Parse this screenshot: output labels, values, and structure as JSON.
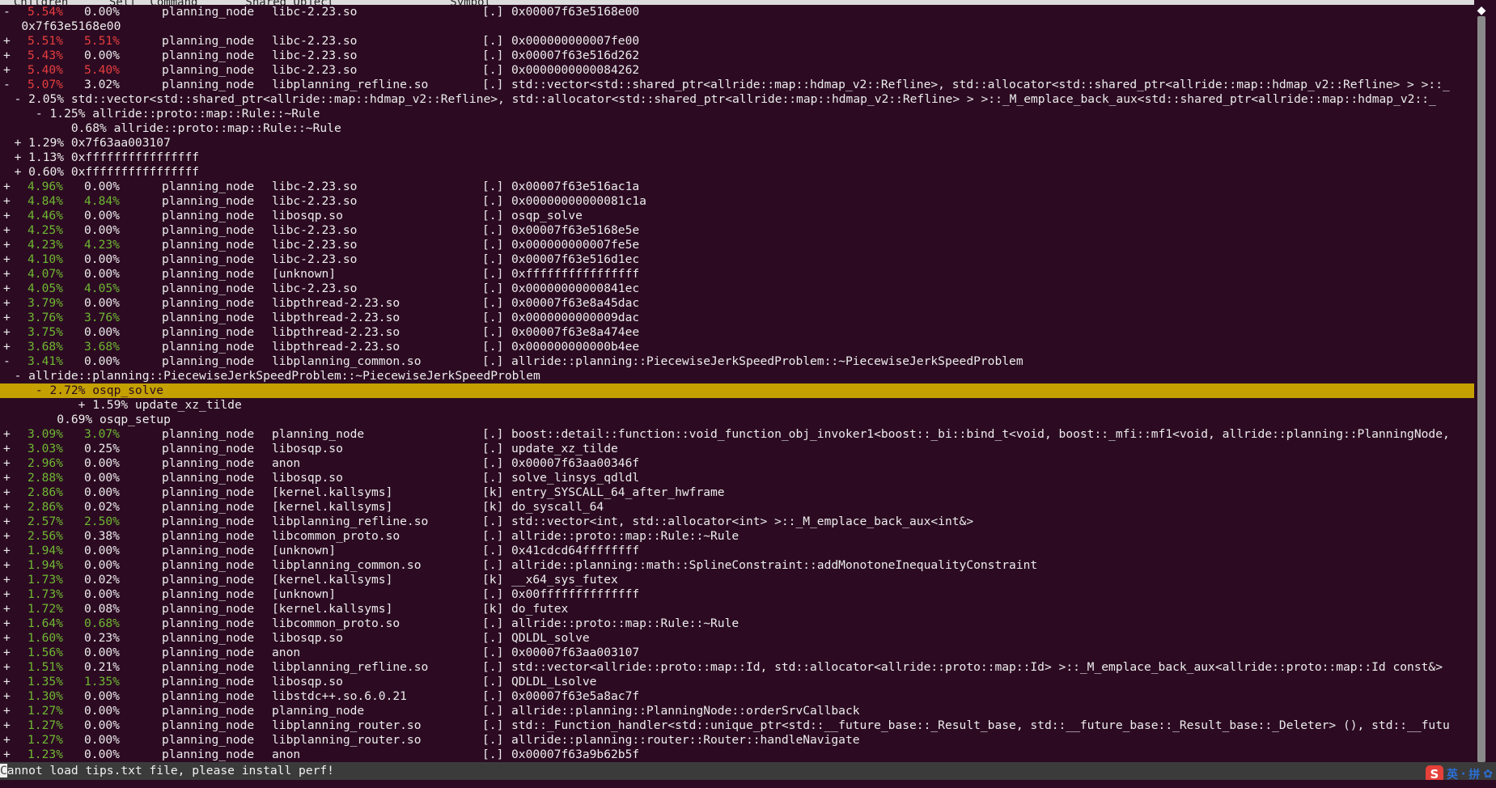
{
  "header": {
    "text": "  Children      Self  Command       Shared Object                 Symbol"
  },
  "lines": [
    {
      "p": "-",
      "c": "5.54%",
      "s": "0.00%",
      "cc": "red",
      "sc": "white",
      "cmd": "planning_node",
      "obj": "libc-2.23.so",
      "typ": "[.]",
      "sym": "0x00007f63e5168e00"
    },
    {
      "t": "   0x7f63e5168e00"
    },
    {
      "p": "+",
      "c": "5.51%",
      "s": "5.51%",
      "cc": "red",
      "sc": "red",
      "cmd": "planning_node",
      "obj": "libc-2.23.so",
      "typ": "[.]",
      "sym": "0x000000000007fe00"
    },
    {
      "p": "+",
      "c": "5.43%",
      "s": "0.00%",
      "cc": "red",
      "sc": "white",
      "cmd": "planning_node",
      "obj": "libc-2.23.so",
      "typ": "[.]",
      "sym": "0x00007f63e516d262"
    },
    {
      "p": "+",
      "c": "5.40%",
      "s": "5.40%",
      "cc": "red",
      "sc": "red",
      "cmd": "planning_node",
      "obj": "libc-2.23.so",
      "typ": "[.]",
      "sym": "0x0000000000084262"
    },
    {
      "p": "-",
      "c": "5.07%",
      "s": "3.02%",
      "cc": "red",
      "sc": "white",
      "cmd": "planning_node",
      "obj": "libplanning_refline.so",
      "typ": "[.]",
      "sym": "std::vector<std::shared_ptr<allride::map::hdmap_v2::Refline>, std::allocator<std::shared_ptr<allride::map::hdmap_v2::Refline> > >::_"
    },
    {
      "t": "  - 2.05% std::vector<std::shared_ptr<allride::map::hdmap_v2::Refline>, std::allocator<std::shared_ptr<allride::map::hdmap_v2::Refline> > >::_M_emplace_back_aux<std::shared_ptr<allride::map::hdmap_v2::_"
    },
    {
      "t": "     - 1.25% allride::proto::map::Rule::~Rule"
    },
    {
      "t": "          0.68% allride::proto::map::Rule::~Rule"
    },
    {
      "t": "  + 1.29% 0x7f63aa003107"
    },
    {
      "t": "  + 1.13% 0xffffffffffffffff"
    },
    {
      "t": "  + 0.60% 0xffffffffffffffff"
    },
    {
      "p": "+",
      "c": "4.96%",
      "s": "0.00%",
      "cc": "green",
      "sc": "white",
      "cmd": "planning_node",
      "obj": "libc-2.23.so",
      "typ": "[.]",
      "sym": "0x00007f63e516ac1a"
    },
    {
      "p": "+",
      "c": "4.84%",
      "s": "4.84%",
      "cc": "green",
      "sc": "green",
      "cmd": "planning_node",
      "obj": "libc-2.23.so",
      "typ": "[.]",
      "sym": "0x00000000000081c1a"
    },
    {
      "p": "+",
      "c": "4.46%",
      "s": "0.00%",
      "cc": "green",
      "sc": "white",
      "cmd": "planning_node",
      "obj": "libosqp.so",
      "typ": "[.]",
      "sym": "osqp_solve"
    },
    {
      "p": "+",
      "c": "4.25%",
      "s": "0.00%",
      "cc": "green",
      "sc": "white",
      "cmd": "planning_node",
      "obj": "libc-2.23.so",
      "typ": "[.]",
      "sym": "0x00007f63e5168e5e"
    },
    {
      "p": "+",
      "c": "4.23%",
      "s": "4.23%",
      "cc": "green",
      "sc": "green",
      "cmd": "planning_node",
      "obj": "libc-2.23.so",
      "typ": "[.]",
      "sym": "0x000000000007fe5e"
    },
    {
      "p": "+",
      "c": "4.10%",
      "s": "0.00%",
      "cc": "green",
      "sc": "white",
      "cmd": "planning_node",
      "obj": "libc-2.23.so",
      "typ": "[.]",
      "sym": "0x00007f63e516d1ec"
    },
    {
      "p": "+",
      "c": "4.07%",
      "s": "0.00%",
      "cc": "green",
      "sc": "white",
      "cmd": "planning_node",
      "obj": "[unknown]",
      "typ": "[.]",
      "sym": "0xffffffffffffffff"
    },
    {
      "p": "+",
      "c": "4.05%",
      "s": "4.05%",
      "cc": "green",
      "sc": "green",
      "cmd": "planning_node",
      "obj": "libc-2.23.so",
      "typ": "[.]",
      "sym": "0x00000000000841ec"
    },
    {
      "p": "+",
      "c": "3.79%",
      "s": "0.00%",
      "cc": "green",
      "sc": "white",
      "cmd": "planning_node",
      "obj": "libpthread-2.23.so",
      "typ": "[.]",
      "sym": "0x00007f63e8a45dac"
    },
    {
      "p": "+",
      "c": "3.76%",
      "s": "3.76%",
      "cc": "green",
      "sc": "green",
      "cmd": "planning_node",
      "obj": "libpthread-2.23.so",
      "typ": "[.]",
      "sym": "0x0000000000009dac"
    },
    {
      "p": "+",
      "c": "3.75%",
      "s": "0.00%",
      "cc": "green",
      "sc": "white",
      "cmd": "planning_node",
      "obj": "libpthread-2.23.so",
      "typ": "[.]",
      "sym": "0x00007f63e8a474ee"
    },
    {
      "p": "+",
      "c": "3.68%",
      "s": "3.68%",
      "cc": "green",
      "sc": "green",
      "cmd": "planning_node",
      "obj": "libpthread-2.23.so",
      "typ": "[.]",
      "sym": "0x000000000000b4ee"
    },
    {
      "p": "-",
      "c": "3.41%",
      "s": "0.00%",
      "cc": "green",
      "sc": "white",
      "cmd": "planning_node",
      "obj": "libplanning_common.so",
      "typ": "[.]",
      "sym": "allride::planning::PiecewiseJerkSpeedProblem::~PiecewiseJerkSpeedProblem"
    },
    {
      "t": "  - allride::planning::PiecewiseJerkSpeedProblem::~PiecewiseJerkSpeedProblem"
    },
    {
      "t": "     - 2.72% osqp_solve",
      "hl": true
    },
    {
      "t": "           + 1.59% update_xz_tilde"
    },
    {
      "t": "        0.69% osqp_setup"
    },
    {
      "p": "+",
      "c": "3.09%",
      "s": "3.07%",
      "cc": "green",
      "sc": "green",
      "cmd": "planning_node",
      "obj": "planning_node",
      "typ": "[.]",
      "sym": "boost::detail::function::void_function_obj_invoker1<boost::_bi::bind_t<void, boost::_mfi::mf1<void, allride::planning::PlanningNode,"
    },
    {
      "p": "+",
      "c": "3.03%",
      "s": "0.25%",
      "cc": "green",
      "sc": "white",
      "cmd": "planning_node",
      "obj": "libosqp.so",
      "typ": "[.]",
      "sym": "update_xz_tilde"
    },
    {
      "p": "+",
      "c": "2.96%",
      "s": "0.00%",
      "cc": "green",
      "sc": "white",
      "cmd": "planning_node",
      "obj": "anon",
      "typ": "[.]",
      "sym": "0x00007f63aa00346f"
    },
    {
      "p": "+",
      "c": "2.88%",
      "s": "0.00%",
      "cc": "green",
      "sc": "white",
      "cmd": "planning_node",
      "obj": "libosqp.so",
      "typ": "[.]",
      "sym": "solve_linsys_qdldl"
    },
    {
      "p": "+",
      "c": "2.86%",
      "s": "0.00%",
      "cc": "green",
      "sc": "white",
      "cmd": "planning_node",
      "obj": "[kernel.kallsyms]",
      "typ": "[k]",
      "sym": "entry_SYSCALL_64_after_hwframe"
    },
    {
      "p": "+",
      "c": "2.86%",
      "s": "0.02%",
      "cc": "green",
      "sc": "white",
      "cmd": "planning_node",
      "obj": "[kernel.kallsyms]",
      "typ": "[k]",
      "sym": "do_syscall_64"
    },
    {
      "p": "+",
      "c": "2.57%",
      "s": "2.50%",
      "cc": "green",
      "sc": "green",
      "cmd": "planning_node",
      "obj": "libplanning_refline.so",
      "typ": "[.]",
      "sym": "std::vector<int, std::allocator<int> >::_M_emplace_back_aux<int&>"
    },
    {
      "p": "+",
      "c": "2.56%",
      "s": "0.38%",
      "cc": "green",
      "sc": "white",
      "cmd": "planning_node",
      "obj": "libcommon_proto.so",
      "typ": "[.]",
      "sym": "allride::proto::map::Rule::~Rule"
    },
    {
      "p": "+",
      "c": "1.94%",
      "s": "0.00%",
      "cc": "green",
      "sc": "white",
      "cmd": "planning_node",
      "obj": "[unknown]",
      "typ": "[.]",
      "sym": "0x41cdcd64ffffffff"
    },
    {
      "p": "+",
      "c": "1.94%",
      "s": "0.00%",
      "cc": "green",
      "sc": "white",
      "cmd": "planning_node",
      "obj": "libplanning_common.so",
      "typ": "[.]",
      "sym": "allride::planning::math::SplineConstraint::addMonotoneInequalityConstraint"
    },
    {
      "p": "+",
      "c": "1.73%",
      "s": "0.02%",
      "cc": "green",
      "sc": "white",
      "cmd": "planning_node",
      "obj": "[kernel.kallsyms]",
      "typ": "[k]",
      "sym": "__x64_sys_futex"
    },
    {
      "p": "+",
      "c": "1.73%",
      "s": "0.00%",
      "cc": "green",
      "sc": "white",
      "cmd": "planning_node",
      "obj": "[unknown]",
      "typ": "[.]",
      "sym": "0x00ffffffffffffff"
    },
    {
      "p": "+",
      "c": "1.72%",
      "s": "0.08%",
      "cc": "green",
      "sc": "white",
      "cmd": "planning_node",
      "obj": "[kernel.kallsyms]",
      "typ": "[k]",
      "sym": "do_futex"
    },
    {
      "p": "+",
      "c": "1.64%",
      "s": "0.68%",
      "cc": "green",
      "sc": "green",
      "cmd": "planning_node",
      "obj": "libcommon_proto.so",
      "typ": "[.]",
      "sym": "allride::proto::map::Rule::~Rule"
    },
    {
      "p": "+",
      "c": "1.60%",
      "s": "0.23%",
      "cc": "green",
      "sc": "white",
      "cmd": "planning_node",
      "obj": "libosqp.so",
      "typ": "[.]",
      "sym": "QDLDL_solve"
    },
    {
      "p": "+",
      "c": "1.56%",
      "s": "0.00%",
      "cc": "green",
      "sc": "white",
      "cmd": "planning_node",
      "obj": "anon",
      "typ": "[.]",
      "sym": "0x00007f63aa003107"
    },
    {
      "p": "+",
      "c": "1.51%",
      "s": "0.21%",
      "cc": "green",
      "sc": "white",
      "cmd": "planning_node",
      "obj": "libplanning_refline.so",
      "typ": "[.]",
      "sym": "std::vector<allride::proto::map::Id, std::allocator<allride::proto::map::Id> >::_M_emplace_back_aux<allride::proto::map::Id const&>"
    },
    {
      "p": "+",
      "c": "1.35%",
      "s": "1.35%",
      "cc": "green",
      "sc": "green",
      "cmd": "planning_node",
      "obj": "libosqp.so",
      "typ": "[.]",
      "sym": "QDLDL_Lsolve"
    },
    {
      "p": "+",
      "c": "1.30%",
      "s": "0.00%",
      "cc": "green",
      "sc": "white",
      "cmd": "planning_node",
      "obj": "libstdc++.so.6.0.21",
      "typ": "[.]",
      "sym": "0x00007f63e5a8ac7f"
    },
    {
      "p": "+",
      "c": "1.27%",
      "s": "0.00%",
      "cc": "green",
      "sc": "white",
      "cmd": "planning_node",
      "obj": "planning_node",
      "typ": "[.]",
      "sym": "allride::planning::PlanningNode::orderSrvCallback"
    },
    {
      "p": "+",
      "c": "1.27%",
      "s": "0.00%",
      "cc": "green",
      "sc": "white",
      "cmd": "planning_node",
      "obj": "libplanning_router.so",
      "typ": "[.]",
      "sym": "std::_Function_handler<std::unique_ptr<std::__future_base::_Result_base, std::__future_base::_Result_base::_Deleter> (), std::__futu"
    },
    {
      "p": "+",
      "c": "1.27%",
      "s": "0.00%",
      "cc": "green",
      "sc": "white",
      "cmd": "planning_node",
      "obj": "libplanning_router.so",
      "typ": "[.]",
      "sym": "allride::planning::router::Router::handleNavigate"
    },
    {
      "p": "+",
      "c": "1.23%",
      "s": "0.00%",
      "cc": "green",
      "sc": "white",
      "cmd": "planning_node",
      "obj": "anon",
      "typ": "[.]",
      "sym": "0x00007f63a9b62b5f"
    }
  ],
  "status": {
    "first_char": "C",
    "rest": "annot load tips.txt file, please install perf!"
  },
  "ime": {
    "logo": "S",
    "items": [
      "英",
      "·",
      "拼",
      "✿"
    ]
  },
  "colors": {
    "red": "#e63e3e",
    "green": "#6fb832",
    "white": "#ececec",
    "background": "#2c0b22",
    "highlight": "#c4a000"
  }
}
